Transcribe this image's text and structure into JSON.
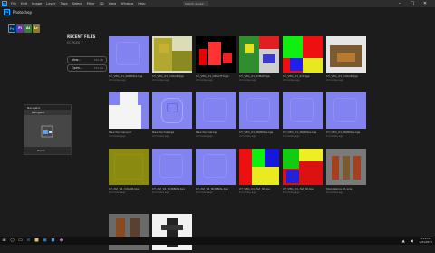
{
  "app": {
    "logo": "Ps",
    "title": "Photoshop"
  },
  "menu": [
    "File",
    "Edit",
    "Image",
    "Layer",
    "Type",
    "Select",
    "Filter",
    "3D",
    "View",
    "Window",
    "Help"
  ],
  "search_stock": "Search Adobe Stock",
  "window_controls": [
    "–",
    "□",
    "✕"
  ],
  "cc_apps": [
    {
      "label": "Ps",
      "color": "#31a8ff",
      "bg": "#0a2a4a"
    },
    {
      "label": "Fl",
      "color": "#ffffff",
      "bg": "#5a3a9a"
    },
    {
      "label": "Ai",
      "color": "#ffffff",
      "bg": "#3a7a3a"
    },
    {
      "label": "Lr",
      "color": "#ffffff",
      "bg": "#8a7a2a"
    }
  ],
  "sidebar": {
    "title": "RECENT FILES",
    "subtitle": "CC FILES",
    "buttons": [
      {
        "label": "New...",
        "hint": "Ctrl+N"
      },
      {
        "label": "Open...",
        "hint": "Ctrl+O"
      }
    ]
  },
  "files": [
    {
      "name": "CT_VEG_01_NORMAL.tga",
      "time": "2 minutes ago",
      "tex": "normal"
    },
    {
      "name": "CT_VEG_01_COLOR.tga",
      "time": "2 minutes ago",
      "tex": "color"
    },
    {
      "name": "CT_VEG_01_OPACITY.tga",
      "time": "2 minutes ago",
      "tex": "opacity"
    },
    {
      "name": "CT_VEG_01_IDMAP.tga",
      "time": "2 minutes ago",
      "tex": "idmap"
    },
    {
      "name": "CT_VEG_01_IDS.tga",
      "time": "2 minutes ago",
      "tex": "ids"
    },
    {
      "name": "CT_VEG_01_COLOR.tga",
      "time": "2 minutes ago",
      "tex": "color2"
    },
    {
      "name": "New Normal.psd",
      "time": "3 minutes ago",
      "tex": "normal_white"
    },
    {
      "name": "New Normal.tga",
      "time": "4 minutes ago",
      "tex": "normal_emboss"
    },
    {
      "name": "New Normal.tga",
      "time": "4 minutes ago",
      "tex": "normal"
    },
    {
      "name": "CT_VEG_01_NORMAL.tga",
      "time": "4 minutes ago",
      "tex": "normal"
    },
    {
      "name": "CT_VEG_01_NORMAL.tga",
      "time": "5 minutes ago",
      "tex": "normal"
    },
    {
      "name": "CT_VEG_01_NORMAL.tga",
      "time": "5 minutes ago",
      "tex": "normal"
    },
    {
      "name": "CT_AVI_01_COLOR.tga",
      "time": "6 minutes ago",
      "tex": "olive"
    },
    {
      "name": "CT_AVI_01_NORMAL.tga",
      "time": "6 minutes ago",
      "tex": "normal"
    },
    {
      "name": "CT_AVI_01_NORMAL.tga",
      "time": "6 minutes ago",
      "tex": "normal"
    },
    {
      "name": "CT_VEG_01_AVI_ID.tga",
      "time": "6 minutes ago",
      "tex": "idmap2"
    },
    {
      "name": "CT_VEG_01_AVI_ID.tga",
      "time": "6 minutes ago",
      "tex": "idmap3"
    },
    {
      "name": "Standalone 01.png",
      "time": "6 minutes ago",
      "tex": "chars"
    },
    {
      "name": "",
      "time": "",
      "tex": "chars_dark"
    },
    {
      "name": "",
      "time": "",
      "tex": "char_white"
    }
  ],
  "panel": {
    "tab": "Navigator",
    "inner_tab": "Navigator",
    "footer": "Zoom"
  },
  "taskbar": {
    "icons": [
      "start-icon",
      "search-icon",
      "taskview-icon",
      "edge-icon",
      "explorer-icon",
      "store-icon",
      "photoshop-icon",
      "app-icon"
    ],
    "clock_time": "3:14 PM",
    "clock_date": "6/21/2017"
  }
}
